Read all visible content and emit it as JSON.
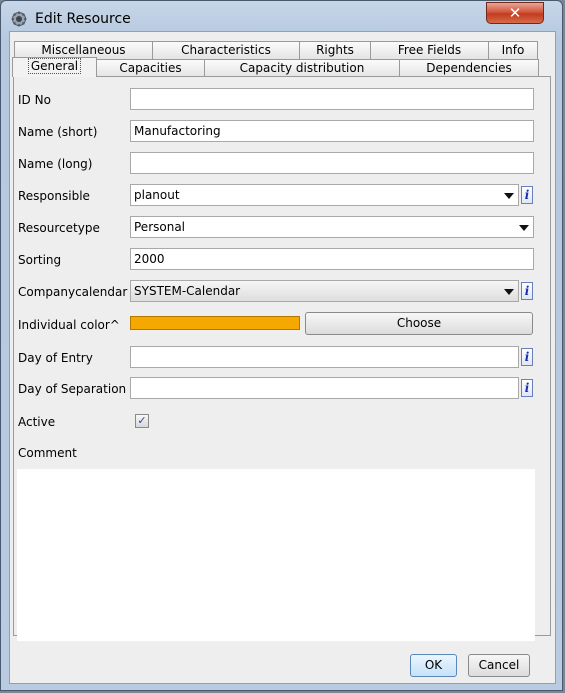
{
  "window": {
    "title": "Edit Resource",
    "close_glyph": "✕"
  },
  "tabs_row1": [
    {
      "label": "Miscellaneous"
    },
    {
      "label": "Characteristics"
    },
    {
      "label": "Rights"
    },
    {
      "label": "Free Fields"
    },
    {
      "label": "Info"
    }
  ],
  "tabs_row2": [
    {
      "label": "General",
      "active": true
    },
    {
      "label": "Capacities"
    },
    {
      "label": "Capacity distribution"
    },
    {
      "label": "Dependencies"
    }
  ],
  "form": {
    "id_no": {
      "label": "ID No",
      "value": ""
    },
    "name_short": {
      "label": "Name (short)",
      "value": "Manufactoring"
    },
    "name_long": {
      "label": "Name (long)",
      "value": ""
    },
    "responsible": {
      "label": "Responsible",
      "value": "planout"
    },
    "resourcetype": {
      "label": "Resourcetype",
      "value": "Personal"
    },
    "sorting": {
      "label": "Sorting",
      "value": "2000"
    },
    "companycalendar": {
      "label": "Companycalendar",
      "value": "SYSTEM-Calendar"
    },
    "individual_color": {
      "label": "Individual color^",
      "color": "#f5a800",
      "button": "Choose"
    },
    "day_of_entry": {
      "label": "Day of Entry",
      "value": ""
    },
    "day_of_separation": {
      "label": "Day of Separation",
      "value": ""
    },
    "active": {
      "label": "Active",
      "checked": true,
      "glyph": "✓"
    },
    "comment": {
      "label": "Comment",
      "value": ""
    }
  },
  "info_glyph": "i",
  "buttons": {
    "ok": "OK",
    "cancel": "Cancel"
  },
  "colors": {
    "accent_color": "#f5a800",
    "close_button": "#c23b1d"
  }
}
